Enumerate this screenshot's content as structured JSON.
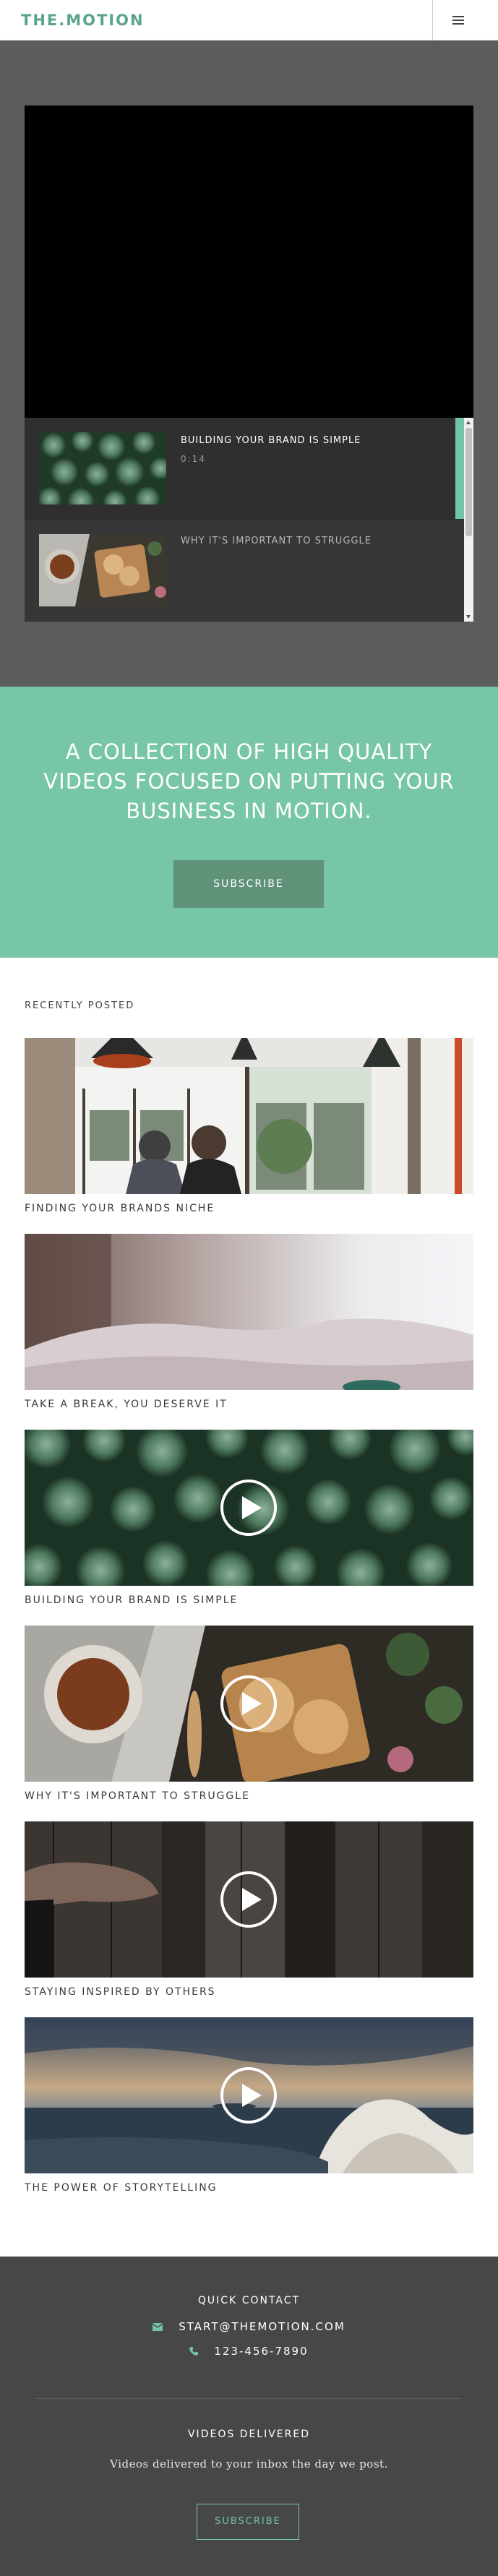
{
  "header": {
    "logo": "THE.MOTION",
    "menu_icon": "hamburger-menu-icon"
  },
  "video": {
    "playlist": [
      {
        "title": "BUILDING YOUR BRAND IS SIMPLE",
        "duration": "0:14",
        "thumb": "succulents"
      },
      {
        "title": "WHY IT'S IMPORTANT TO STRUGGLE",
        "thumb": "tea-and-cookies"
      }
    ]
  },
  "banner": {
    "text": "A COLLECTION OF HIGH QUALITY VIDEOS FOCUSED ON PUTTING YOUR BUSINESS IN MOTION.",
    "button": "SUBSCRIBE"
  },
  "recent": {
    "heading": "RECENTLY POSTED",
    "posts": [
      {
        "title": "FINDING YOUR BRANDS NICHE",
        "image": "cafe-interior",
        "video": false
      },
      {
        "title": "TAKE A BREAK, YOU DESERVE IT",
        "image": "blurred-bed",
        "video": false
      },
      {
        "title": "BUILDING YOUR BRAND IS SIMPLE",
        "image": "succulents",
        "video": true
      },
      {
        "title": "WHY IT'S IMPORTANT TO STRUGGLE",
        "image": "tea-and-cookies",
        "video": true
      },
      {
        "title": "STAYING INSPIRED BY OTHERS",
        "image": "boots-on-wood",
        "video": true
      },
      {
        "title": "THE POWER OF STORYTELLING",
        "image": "ocean-waves",
        "video": true
      }
    ],
    "play_icon": "play-icon"
  },
  "footer": {
    "contact_heading": "QUICK CONTACT",
    "email": "START@THEMOTION.COM",
    "email_icon": "envelope-icon",
    "phone": "123-456-7890",
    "phone_icon": "phone-icon",
    "videos_heading": "VIDEOS DELIVERED",
    "videos_text": "Videos delivered to your inbox the day we post.",
    "button": "SUBSCRIBE"
  },
  "colors": {
    "brand": "#5ba58b",
    "banner": "#77c6a6",
    "button": "#5f9279",
    "footer": "#474747",
    "video_bg": "#5c5c5c"
  }
}
